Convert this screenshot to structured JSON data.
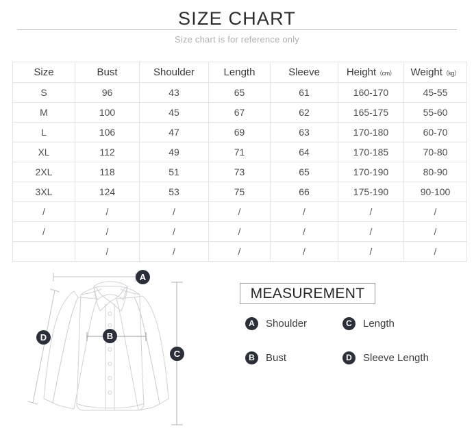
{
  "header": {
    "title": "SIZE CHART",
    "subtitle": "Size chart is for reference only"
  },
  "table": {
    "columns": [
      {
        "label": "Size",
        "unit": ""
      },
      {
        "label": "Bust",
        "unit": ""
      },
      {
        "label": "Shoulder",
        "unit": ""
      },
      {
        "label": "Length",
        "unit": ""
      },
      {
        "label": "Sleeve",
        "unit": ""
      },
      {
        "label": "Height",
        "unit": "（cm）"
      },
      {
        "label": "Weight",
        "unit": "（kg）"
      }
    ],
    "rows": [
      [
        "S",
        "96",
        "43",
        "65",
        "61",
        "160-170",
        "45-55"
      ],
      [
        "M",
        "100",
        "45",
        "67",
        "62",
        "165-175",
        "55-60"
      ],
      [
        "L",
        "106",
        "47",
        "69",
        "63",
        "170-180",
        "60-70"
      ],
      [
        "XL",
        "112",
        "49",
        "71",
        "64",
        "170-185",
        "70-80"
      ],
      [
        "2XL",
        "118",
        "51",
        "73",
        "65",
        "170-190",
        "80-90"
      ],
      [
        "3XL",
        "124",
        "53",
        "75",
        "66",
        "175-190",
        "90-100"
      ],
      [
        "/",
        "/",
        "/",
        "/",
        "/",
        "/",
        "/"
      ],
      [
        "/",
        "/",
        "/",
        "/",
        "/",
        "/",
        "/"
      ],
      [
        "",
        "/",
        "/",
        "/",
        "/",
        "/",
        "/"
      ]
    ]
  },
  "diagram": {
    "badges": [
      {
        "id": "A",
        "measure": "Shoulder"
      },
      {
        "id": "B",
        "measure": "Bust"
      },
      {
        "id": "C",
        "measure": "Length"
      },
      {
        "id": "D",
        "measure": "Sleeve Length"
      }
    ]
  },
  "measurement": {
    "box_title": "MEASUREMENT",
    "legend": [
      {
        "key": "A",
        "label": "Shoulder"
      },
      {
        "key": "B",
        "label": "Bust"
      },
      {
        "key": "C",
        "label": "Length"
      },
      {
        "key": "D",
        "label": "Sleeve Length"
      }
    ]
  },
  "colors": {
    "badge": "#2b2f3a",
    "title": "#2d2d2d",
    "subtitle": "#b0b0b0",
    "table_border": "#e4e4e4",
    "line": "#b9b9b9",
    "garment_stroke": "#cfd2d6"
  }
}
